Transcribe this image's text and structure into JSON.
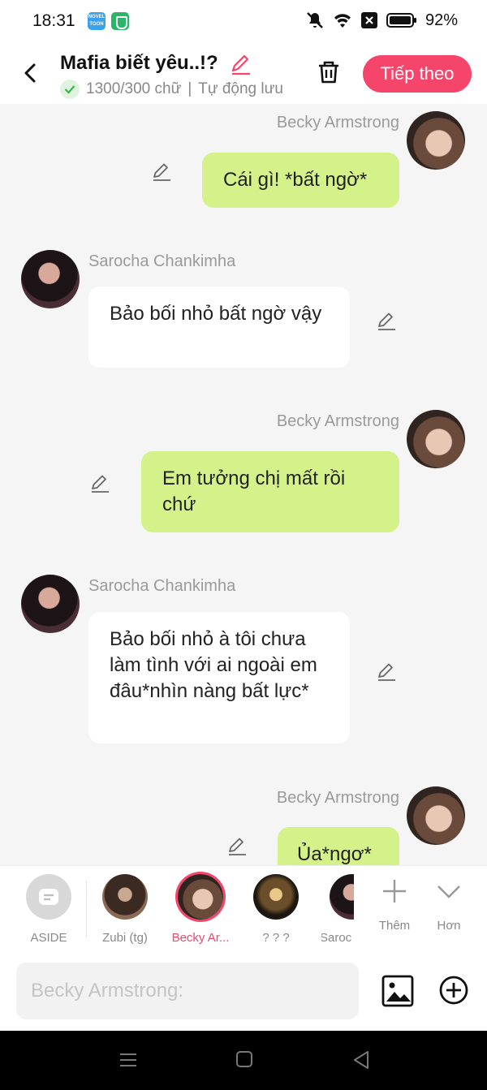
{
  "status_bar": {
    "time": "18:31",
    "app1_label": "NOVEL TOON",
    "battery": "92%"
  },
  "header": {
    "title": "Mafia biết yêu..!?",
    "word_count": "1300/300 chữ",
    "autosave": "Tự động lưu",
    "next_label": "Tiếp theo"
  },
  "messages": [
    {
      "sender": "Becky Armstrong",
      "text": "Cái gì! *bất ngờ*",
      "side": "right"
    },
    {
      "sender": "Sarocha Chankimha",
      "text": "Bảo bối nhỏ bất ngờ vậy",
      "side": "left"
    },
    {
      "sender": "Becky Armstrong",
      "text": "Em tưởng chị mất rồi chứ",
      "side": "right"
    },
    {
      "sender": "Sarocha Chankimha",
      "text": "Bảo bối nhỏ à tôi chưa làm tình với ai ngoài em đâu*nhìn nàng bất lực*",
      "side": "left"
    },
    {
      "sender": "Becky Armstrong",
      "text": "Ủa*ngơ*",
      "side": "right"
    }
  ],
  "characters": [
    {
      "label": "ASIDE"
    },
    {
      "label": "Zubi (tg)"
    },
    {
      "label": "Becky Ar..."
    },
    {
      "label": "? ? ?"
    },
    {
      "label": "Saroc"
    },
    {
      "label": "Thêm"
    },
    {
      "label": "Hơn"
    }
  ],
  "input": {
    "placeholder": "Becky Armstrong:"
  },
  "colors": {
    "accent": "#f5456a",
    "green_bubble": "#d5f28a",
    "background": "#f5f5f5"
  }
}
